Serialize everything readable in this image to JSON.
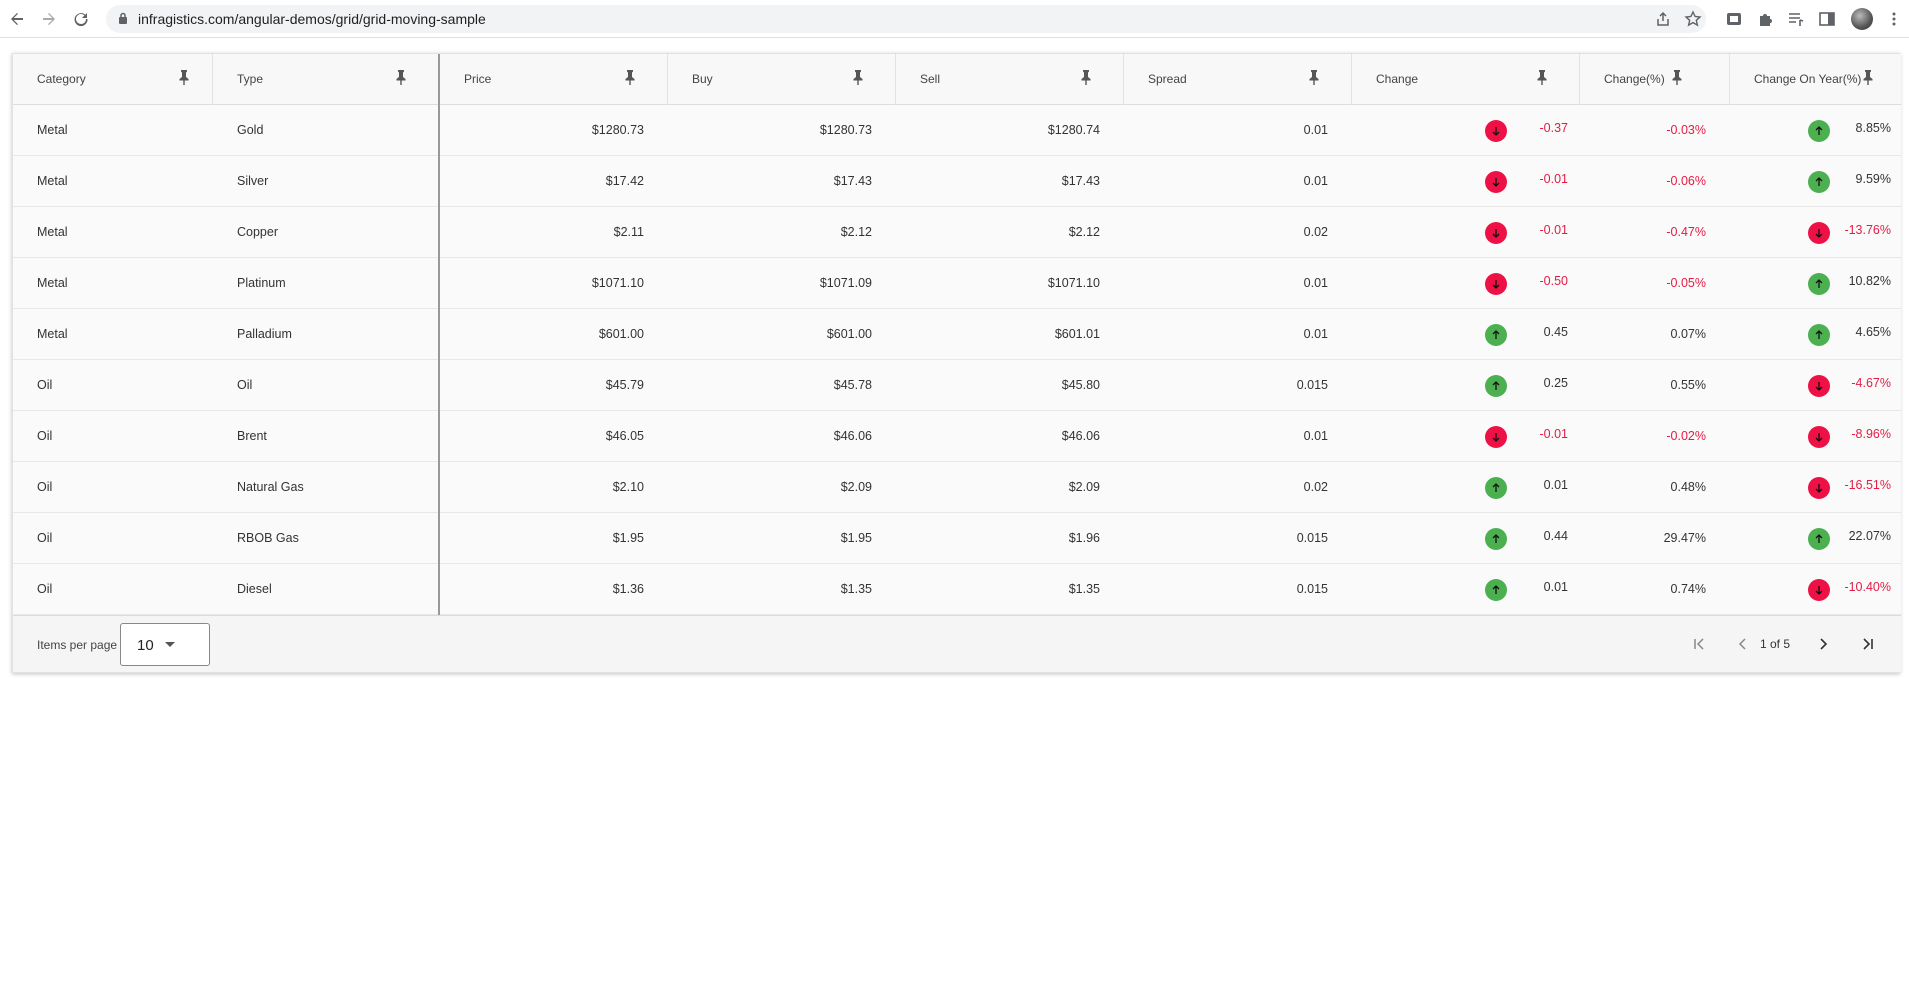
{
  "browser": {
    "url": "infragistics.com/angular-demos/grid/grid-moving-sample"
  },
  "colors": {
    "negative": "#e41c45",
    "up_indicator": "#4caf50",
    "down_indicator": "#ee1145"
  },
  "grid": {
    "columns": [
      {
        "key": "category",
        "label": "Category"
      },
      {
        "key": "type",
        "label": "Type"
      },
      {
        "key": "price",
        "label": "Price"
      },
      {
        "key": "buy",
        "label": "Buy"
      },
      {
        "key": "sell",
        "label": "Sell"
      },
      {
        "key": "spread",
        "label": "Spread"
      },
      {
        "key": "change",
        "label": "Change"
      },
      {
        "key": "change_pct",
        "label": "Change(%)"
      },
      {
        "key": "change_year",
        "label": "Change On Year(%)"
      }
    ],
    "rows": [
      {
        "category": "Metal",
        "type": "Gold",
        "price": "$1280.73",
        "buy": "$1280.73",
        "sell": "$1280.74",
        "spread": "0.01",
        "change": "-0.37",
        "change_dir": "down",
        "change_pct": "-0.03%",
        "change_year": "8.85%",
        "year_dir": "up"
      },
      {
        "category": "Metal",
        "type": "Silver",
        "price": "$17.42",
        "buy": "$17.43",
        "sell": "$17.43",
        "spread": "0.01",
        "change": "-0.01",
        "change_dir": "down",
        "change_pct": "-0.06%",
        "change_year": "9.59%",
        "year_dir": "up"
      },
      {
        "category": "Metal",
        "type": "Copper",
        "price": "$2.11",
        "buy": "$2.12",
        "sell": "$2.12",
        "spread": "0.02",
        "change": "-0.01",
        "change_dir": "down",
        "change_pct": "-0.47%",
        "change_year": "-13.76%",
        "year_dir": "down"
      },
      {
        "category": "Metal",
        "type": "Platinum",
        "price": "$1071.10",
        "buy": "$1071.09",
        "sell": "$1071.10",
        "spread": "0.01",
        "change": "-0.50",
        "change_dir": "down",
        "change_pct": "-0.05%",
        "change_year": "10.82%",
        "year_dir": "up"
      },
      {
        "category": "Metal",
        "type": "Palladium",
        "price": "$601.00",
        "buy": "$601.00",
        "sell": "$601.01",
        "spread": "0.01",
        "change": "0.45",
        "change_dir": "up",
        "change_pct": "0.07%",
        "change_year": "4.65%",
        "year_dir": "up"
      },
      {
        "category": "Oil",
        "type": "Oil",
        "price": "$45.79",
        "buy": "$45.78",
        "sell": "$45.80",
        "spread": "0.015",
        "change": "0.25",
        "change_dir": "up",
        "change_pct": "0.55%",
        "change_year": "-4.67%",
        "year_dir": "down"
      },
      {
        "category": "Oil",
        "type": "Brent",
        "price": "$46.05",
        "buy": "$46.06",
        "sell": "$46.06",
        "spread": "0.01",
        "change": "-0.01",
        "change_dir": "down",
        "change_pct": "-0.02%",
        "change_year": "-8.96%",
        "year_dir": "down"
      },
      {
        "category": "Oil",
        "type": "Natural Gas",
        "price": "$2.10",
        "buy": "$2.09",
        "sell": "$2.09",
        "spread": "0.02",
        "change": "0.01",
        "change_dir": "up",
        "change_pct": "0.48%",
        "change_year": "-16.51%",
        "year_dir": "down"
      },
      {
        "category": "Oil",
        "type": "RBOB Gas",
        "price": "$1.95",
        "buy": "$1.95",
        "sell": "$1.96",
        "spread": "0.015",
        "change": "0.44",
        "change_dir": "up",
        "change_pct": "29.47%",
        "change_year": "22.07%",
        "year_dir": "up"
      },
      {
        "category": "Oil",
        "type": "Diesel",
        "price": "$1.36",
        "buy": "$1.35",
        "sell": "$1.35",
        "spread": "0.015",
        "change": "0.01",
        "change_dir": "up",
        "change_pct": "0.74%",
        "change_year": "-10.40%",
        "year_dir": "down"
      }
    ]
  },
  "paginator": {
    "items_per_page_label": "Items per page",
    "items_per_page_value": "10",
    "page_text": "1 of 5"
  }
}
